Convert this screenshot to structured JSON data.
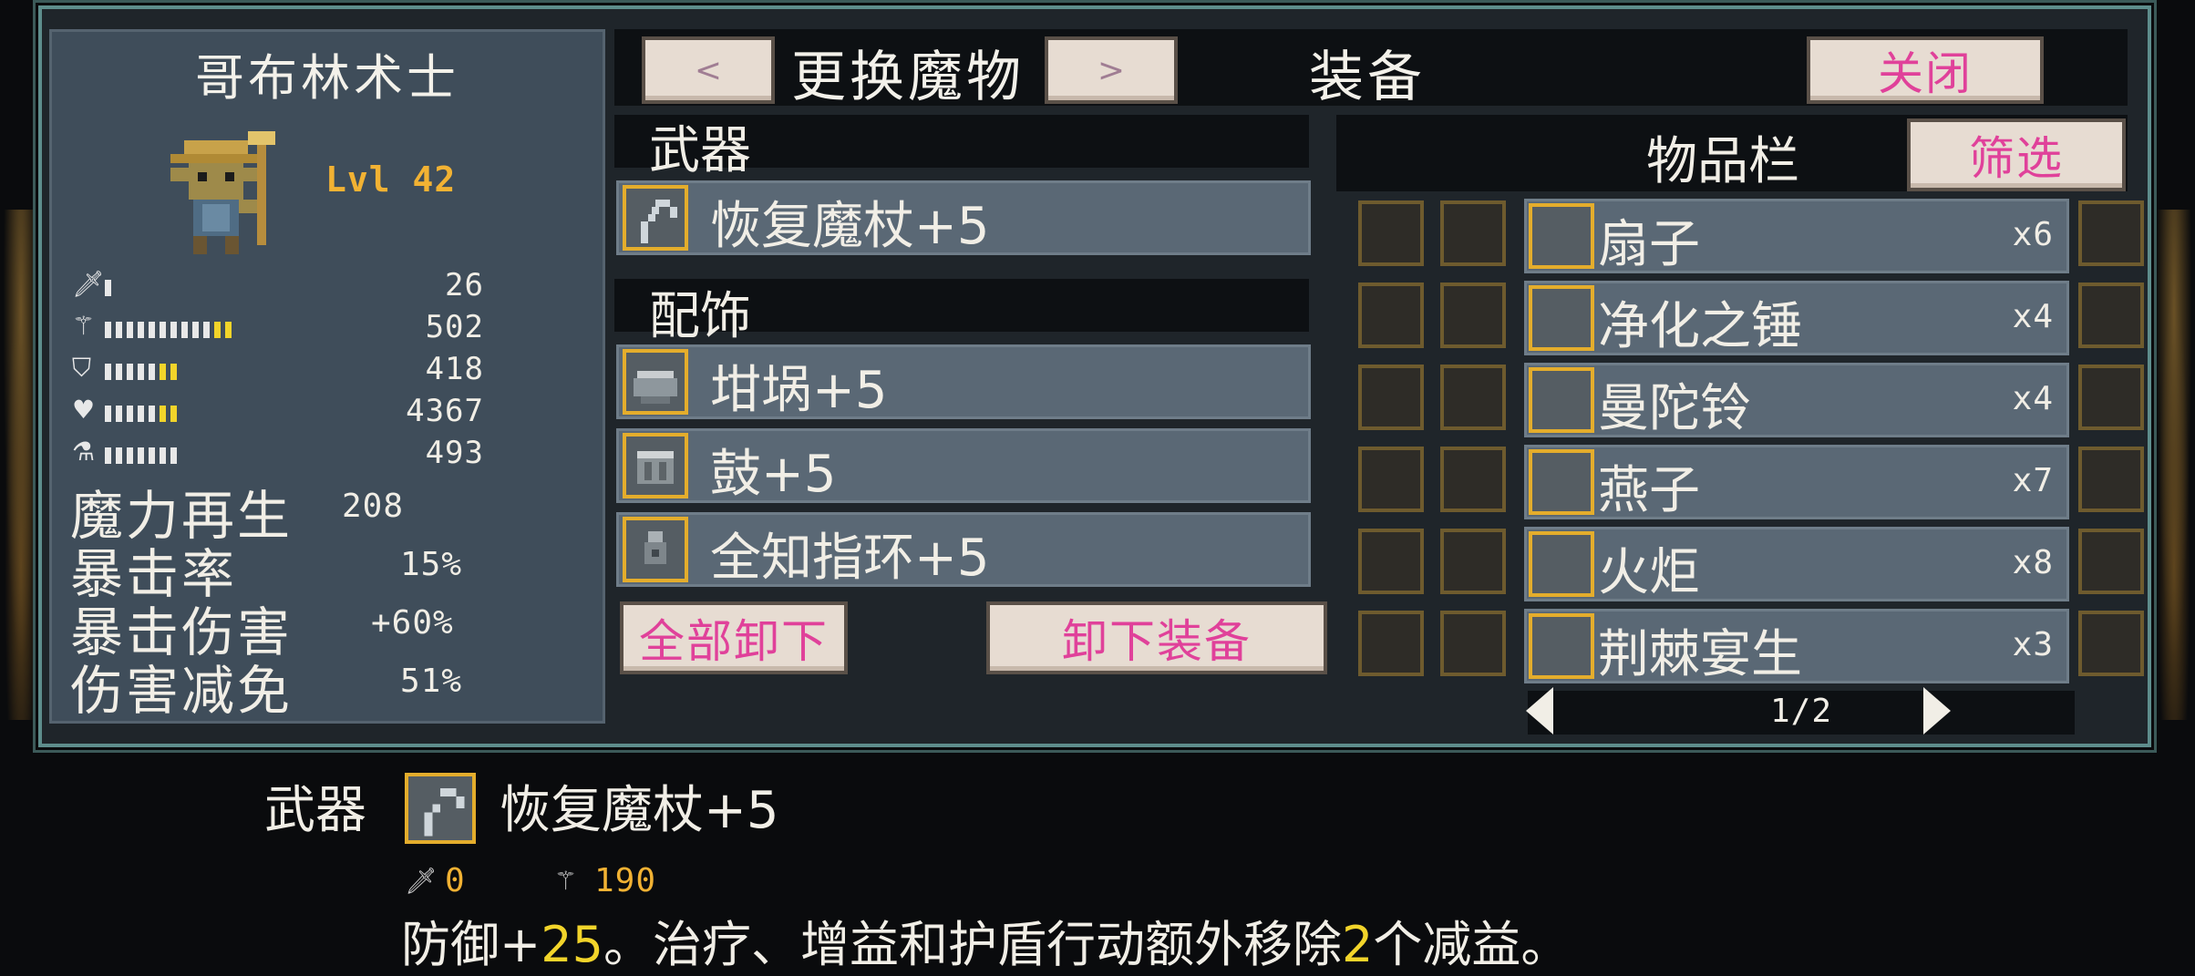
{
  "character": {
    "name": "哥布林术士",
    "level": "Lvl 42",
    "stats": [
      {
        "icon": "sword-icon",
        "value": "26",
        "bars_white": 1,
        "bars_yellow": 0
      },
      {
        "icon": "staff-icon",
        "value": "502",
        "bars_white": 10,
        "bars_yellow": 2
      },
      {
        "icon": "shield-icon",
        "value": "418",
        "bars_white": 5,
        "bars_yellow": 2
      },
      {
        "icon": "heart-icon",
        "value": "4367",
        "bars_white": 5,
        "bars_yellow": 2
      },
      {
        "icon": "flask-icon",
        "value": "493",
        "bars_white": 7,
        "bars_yellow": 0
      }
    ],
    "extra_stats": [
      {
        "label": "魔力再生",
        "value": "208"
      },
      {
        "label": "暴击率",
        "value": "15%"
      },
      {
        "label": "暴击伤害",
        "value": "+60%"
      },
      {
        "label": "伤害减免",
        "value": "51%"
      }
    ]
  },
  "header": {
    "prev_label": "<",
    "next_label": ">",
    "switch_label": "更换魔物",
    "title": "装备",
    "close_label": "关闭"
  },
  "equipment": {
    "weapon_header": "武器",
    "weapon": {
      "name": "恢复魔杖+5",
      "icon": "staff-icon"
    },
    "accessory_header": "配饰",
    "accessories": [
      {
        "name": "坩埚+5",
        "icon": "cauldron-icon"
      },
      {
        "name": "鼓+5",
        "icon": "drum-icon"
      },
      {
        "name": "全知指环+5",
        "icon": "ring-icon"
      }
    ],
    "unequip_all_label": "全部卸下",
    "unequip_label": "卸下装备"
  },
  "inventory": {
    "title": "物品栏",
    "filter_label": "筛选",
    "items": [
      {
        "name": "扇子",
        "count": "x6"
      },
      {
        "name": "净化之锤",
        "count": "x4"
      },
      {
        "name": "曼陀铃",
        "count": "x4"
      },
      {
        "name": "燕子",
        "count": "x7"
      },
      {
        "name": "火炬",
        "count": "x8"
      },
      {
        "name": "荆棘宴生",
        "count": "x3"
      }
    ],
    "page": "1/2"
  },
  "tooltip": {
    "slot_label": "武器",
    "item_name": "恢复魔杖+5",
    "attack_value": "0",
    "magic_value": "190",
    "desc_prefix": "防御+",
    "desc_highlight1": "25",
    "desc_middle": "。治疗、增益和护盾行动额外移除",
    "desc_highlight2": "2",
    "desc_suffix": "个减益。"
  },
  "colors": {
    "accent_pink": "#e0419a",
    "gold": "#f2b233",
    "frame_teal": "#5e8d8c",
    "highlight_yellow": "#f2d42a"
  }
}
